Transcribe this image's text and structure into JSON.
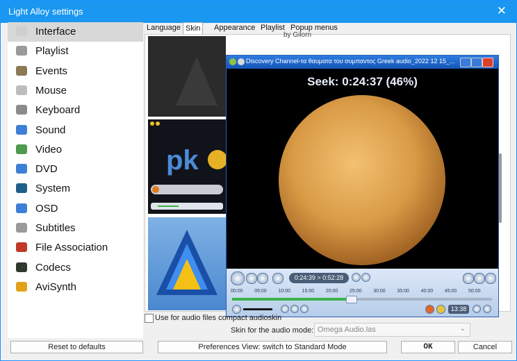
{
  "window": {
    "title": "Light Alloy settings",
    "close_glyph": "✕"
  },
  "sidebar": {
    "items": [
      {
        "label": "Interface",
        "icon": "interface-icon",
        "color": "#cfcfcf"
      },
      {
        "label": "Playlist",
        "icon": "playlist-icon",
        "color": "#9a9a9a"
      },
      {
        "label": "Events",
        "icon": "events-icon",
        "color": "#8c7a55"
      },
      {
        "label": "Mouse",
        "icon": "mouse-icon",
        "color": "#bdbdbd"
      },
      {
        "label": "Keyboard",
        "icon": "keyboard-icon",
        "color": "#8b8b8b"
      },
      {
        "label": "Sound",
        "icon": "sound-icon",
        "color": "#3d7fd6"
      },
      {
        "label": "Video",
        "icon": "video-icon",
        "color": "#4e9a4e"
      },
      {
        "label": "DVD",
        "icon": "dvd-icon",
        "color": "#3d7fd6"
      },
      {
        "label": "System",
        "icon": "system-icon",
        "color": "#1f5f8b"
      },
      {
        "label": "OSD",
        "icon": "osd-icon",
        "color": "#3d7fd6"
      },
      {
        "label": "Subtitles",
        "icon": "subtitles-icon",
        "color": "#9a9a9a"
      },
      {
        "label": "File Association",
        "icon": "file-association-icon",
        "color": "#c0392b"
      },
      {
        "label": "Codecs",
        "icon": "codecs-icon",
        "color": "#2f3a2f"
      },
      {
        "label": "AviSynth",
        "icon": "avisynth-icon",
        "color": "#e0a21a"
      }
    ]
  },
  "tabs": [
    "Language",
    "Skin",
    "Appearance",
    "Playlist",
    "Popup menus"
  ],
  "skin": {
    "author_text": "by Gilorn"
  },
  "player": {
    "title": "Discovery Channel-τα θαυματα του συμπαντος Greek audio_2022 12 15_...",
    "seek_osd": "Seek: 0:24:37 (46%)",
    "time_display": "0:24:39 > 0:52:28",
    "timeline_ticks": [
      "00:00",
      "05:00",
      "10:00",
      "15:00",
      "20:00",
      "25:00",
      "30:00",
      "35:00",
      "40:00",
      "45:00",
      "50:00"
    ],
    "progress_fraction": 0.46,
    "clock": "13:38"
  },
  "audio_skin": {
    "checkbox_label": "Use for audio files compact audioskin",
    "mode_label": "Skin for the audio mode:",
    "mode_value": "Omega Audio.las"
  },
  "footer": {
    "reset_label": "Reset to defaults",
    "prefs_label": "Preferences View: switch to Standard Mode",
    "ok_label": "OK",
    "cancel_label": "Cancel"
  }
}
